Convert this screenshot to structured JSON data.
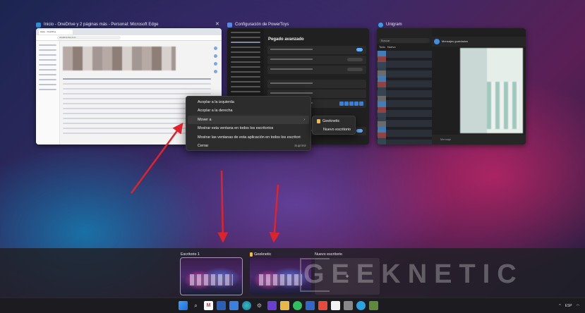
{
  "windows": {
    "edge": {
      "title": "Inicio - OneDrive y 2 páginas más - Personal: Microsoft Edge",
      "tab": "Inicio - OneDrive",
      "url": "onedrive.live.com"
    },
    "powertoys": {
      "title": "Configuración de PowerToys",
      "heading": "Pegado avanzado"
    },
    "unigram": {
      "title": "Unigram",
      "search": "Buscar",
      "tab_all": "Todo",
      "tab_unread": "Nuevo",
      "chat_title": "Mensajes guardados",
      "message_placeholder": "Mensaje"
    }
  },
  "context_menu": {
    "items": [
      {
        "label": "Acoplar a la izquierda"
      },
      {
        "label": "Acoplar a la derecha"
      },
      {
        "label": "Mover a",
        "has_submenu": true,
        "arrow": "›"
      },
      {
        "label": "Mostrar esta ventana en todos los escritorios"
      },
      {
        "label": "Mostrar las ventanas de esta aplicación en todos los escritori"
      },
      {
        "label": "Cerrar",
        "shortcut": "Suprimir"
      }
    ],
    "submenu": [
      {
        "label": "Geeknetic",
        "icon": "folder-icon"
      },
      {
        "label": "Nuevo escritorio"
      }
    ]
  },
  "desktops": [
    {
      "label": "Escritorio 1"
    },
    {
      "label": "Geeknetic"
    }
  ],
  "new_desktop": {
    "label": "Nuevo escritorio",
    "plus": "+"
  },
  "watermark": "GEEKNETIC",
  "taskbar": {
    "icons": [
      "windows-icon",
      "search-icon",
      "gmail-icon",
      "word-icon",
      "docs-icon",
      "edge-icon",
      "settings-icon",
      "obsidian-icon",
      "files-icon",
      "whatsapp-icon",
      "powertoys-icon",
      "todoist-icon",
      "calendar-icon",
      "security-icon",
      "telegram-icon",
      "minecraft-icon"
    ],
    "tray_language": "ESP",
    "tray_chevron": "^"
  },
  "colors": {
    "accent": "#5ab0ff",
    "arrow": "#e0232b"
  }
}
